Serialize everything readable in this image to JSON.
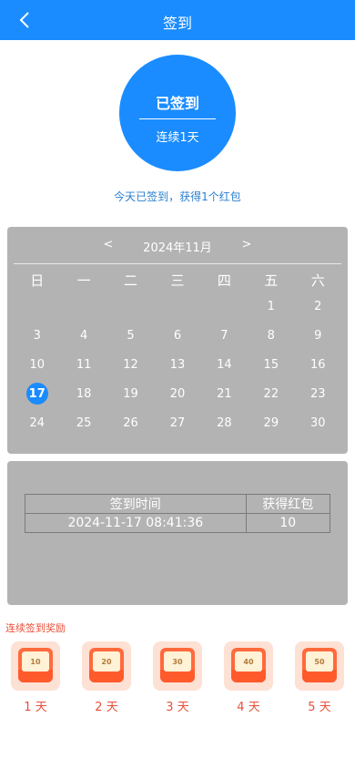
{
  "header": {
    "title": "签到",
    "back_icon": "chevron-left-icon"
  },
  "status": {
    "label": "已签到",
    "streak": "连续1天"
  },
  "message": "今天已签到，获得1个红包",
  "calendar": {
    "prev": "<",
    "month": "2024年11月",
    "next": ">",
    "weekdays": [
      "日",
      "一",
      "二",
      "三",
      "四",
      "五",
      "六"
    ],
    "weeks": [
      [
        "",
        "",
        "",
        "",
        "",
        "1",
        "2"
      ],
      [
        "3",
        "4",
        "5",
        "6",
        "7",
        "8",
        "9"
      ],
      [
        "10",
        "11",
        "12",
        "13",
        "14",
        "15",
        "16"
      ],
      [
        "17",
        "18",
        "19",
        "20",
        "21",
        "22",
        "23"
      ],
      [
        "24",
        "25",
        "26",
        "27",
        "28",
        "29",
        "30"
      ]
    ],
    "today": "17",
    "accent_color": "#1a8cff"
  },
  "records": {
    "headers": [
      "签到时间",
      "获得红包"
    ],
    "rows": [
      [
        "2024-11-17 08:41:36",
        "10"
      ]
    ]
  },
  "rewards": {
    "title": "连续签到奖励",
    "items": [
      {
        "amount": "10",
        "day": "1 天"
      },
      {
        "amount": "20",
        "day": "2 天"
      },
      {
        "amount": "30",
        "day": "3 天"
      },
      {
        "amount": "40",
        "day": "4 天"
      },
      {
        "amount": "50",
        "day": "5 天"
      }
    ]
  }
}
